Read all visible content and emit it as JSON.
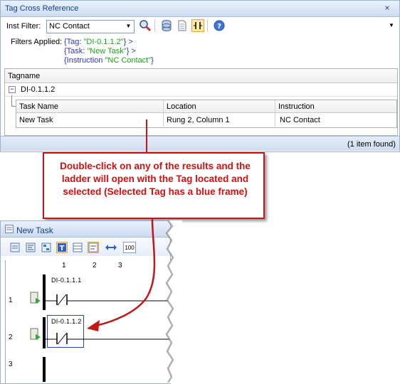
{
  "panel": {
    "title": "Tag Cross Reference",
    "close_glyph": "×",
    "filter_label": "Inst Filter:",
    "filter_value": "NC Contact",
    "filters_applied_label": "Filters Applied:",
    "filters": [
      {
        "prefix": "{Tag: ",
        "value": "\"DI-0.1.1.2\"",
        "suffix": "} >"
      },
      {
        "prefix": "{Task: ",
        "value": "\"New Task\"",
        "suffix": "} >"
      },
      {
        "prefix": "{Instruction ",
        "value": "\"NC Contact\"",
        "suffix": "}"
      }
    ],
    "column_header": "Tagname",
    "group_label": "DI-0.1.1.2",
    "subgrid": {
      "columns": [
        "Task Name",
        "Location",
        "Instruction"
      ],
      "row": [
        "New Task",
        "Rung 2, Column 1",
        "NC Contact"
      ]
    },
    "status": "(1 item found)"
  },
  "callout": {
    "text": "Double-click on any of the results and the ladder will open with the Tag located and selected (Selected Tag has a blue frame)"
  },
  "ladder_window": {
    "title": "New Task",
    "toolbar_zoom": "100",
    "columns": [
      "1",
      "2",
      "3"
    ],
    "rungs": [
      "1",
      "2",
      "3"
    ],
    "contacts": [
      {
        "label": "DI-0.1.1.1"
      },
      {
        "label": "DI-0.1.1.2",
        "selected": true
      }
    ]
  },
  "colors": {
    "accent": "#15428b",
    "callout_red": "#d41010",
    "selection_blue": "#2b3bd6",
    "filter_blue": "#2d35b8",
    "filter_green": "#19a319"
  }
}
